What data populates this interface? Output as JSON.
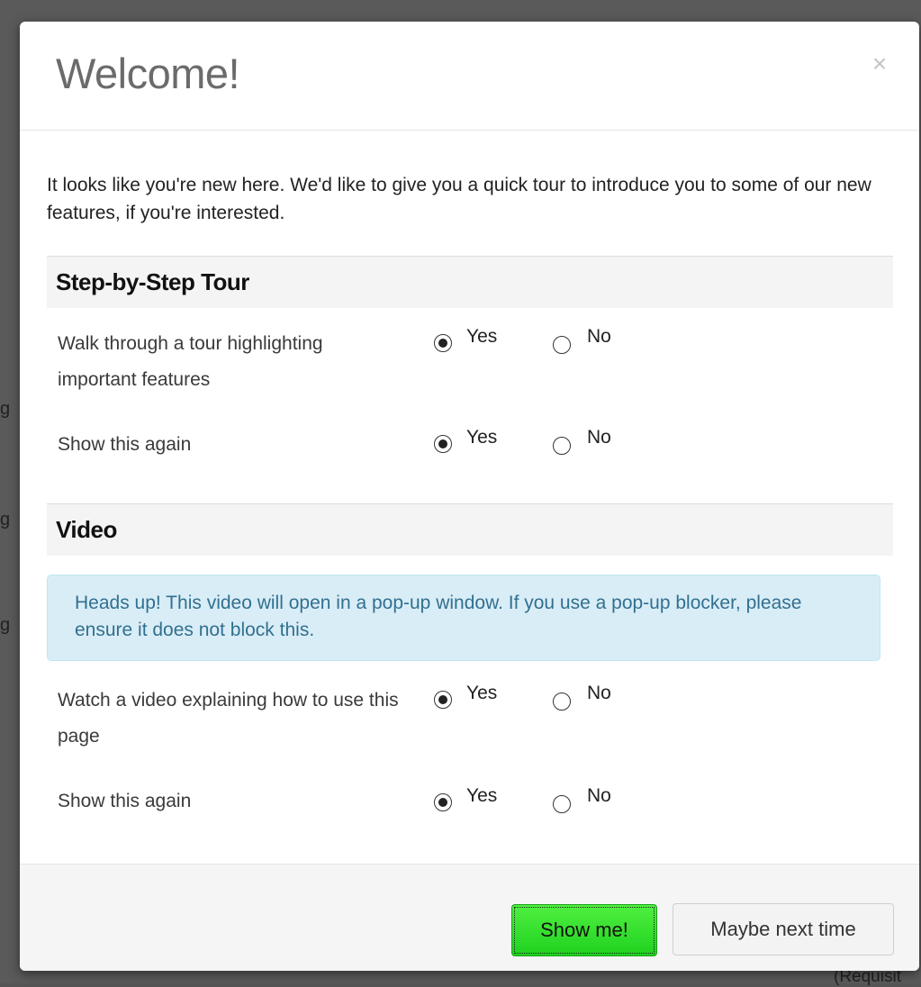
{
  "modal": {
    "title": "Welcome!",
    "close_symbol": "×",
    "intro": "It looks like you're new here. We'd like to give you a quick tour to introduce you to some of our new features, if you're interested."
  },
  "tour_section": {
    "heading": "Step-by-Step Tour",
    "rows": [
      {
        "label": "Walk through a tour highlighting important features",
        "selected": "Yes"
      },
      {
        "label": "Show this again",
        "selected": "Yes"
      }
    ]
  },
  "video_section": {
    "heading": "Video",
    "alert": "Heads up! This video will open in a pop-up window. If you use a pop-up blocker, please ensure it does not block this.",
    "rows": [
      {
        "label": "Watch a video explaining how to use this page",
        "selected": "Yes"
      },
      {
        "label": "Show this again",
        "selected": "Yes"
      }
    ]
  },
  "radio_options": {
    "yes": "Yes",
    "no": "No"
  },
  "footer": {
    "primary_label": "Show me!",
    "secondary_label": "Maybe next time"
  },
  "background": {
    "partial_text": "(Requisit",
    "colors": {
      "overlay": "#5a5a5a"
    }
  },
  "colors": {
    "primary_button": "#2fdc2a",
    "alert_bg": "#d9edf7",
    "alert_text": "#31708f"
  }
}
